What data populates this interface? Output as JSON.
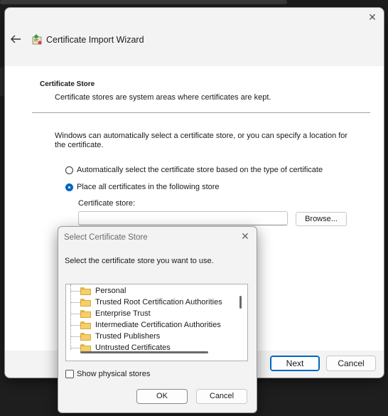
{
  "wizard": {
    "title": "Certificate Import Wizard",
    "close_icon": "close-icon",
    "back_icon": "back-arrow-icon",
    "section_heading": "Certificate Store",
    "section_desc": "Certificate stores are system areas where certificates are kept.",
    "intro": "Windows can automatically select a certificate store, or you can specify a location for the certificate.",
    "radio_auto_label": "Automatically select the certificate store based on the type of certificate",
    "radio_place_label": "Place all certificates in the following store",
    "selected_option": "place",
    "store_label": "Certificate store:",
    "store_value": "",
    "browse_label": "Browse...",
    "next_label": "Next",
    "cancel_label": "Cancel"
  },
  "dialog": {
    "title": "Select Certificate Store",
    "prompt": "Select the certificate store you want to use.",
    "stores": [
      "Personal",
      "Trusted Root Certification Authorities",
      "Enterprise Trust",
      "Intermediate Certification Authorities",
      "Trusted Publishers",
      "Untrusted Certificates"
    ],
    "show_physical_label": "Show physical stores",
    "show_physical_checked": false,
    "ok_label": "OK",
    "cancel_label": "Cancel"
  },
  "colors": {
    "accent": "#0067c0",
    "window_bg": "#f3f3f3",
    "content_bg": "#ffffff"
  }
}
